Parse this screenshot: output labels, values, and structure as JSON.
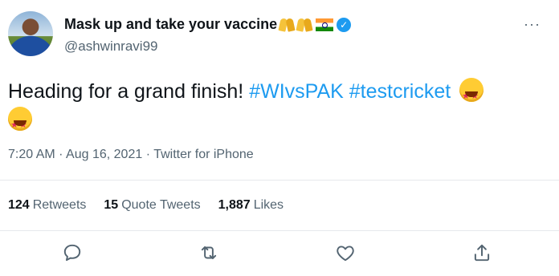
{
  "user": {
    "display_name": "Mask up and take your vaccine",
    "handle": "@ashwinravi99",
    "verified": true,
    "avatar": "avatar-photo"
  },
  "tweet": {
    "text_plain": "Heading for a grand finish! ",
    "hashtags": [
      "#WIvsPAK",
      "#testcricket"
    ],
    "emoji": "star-struck-emoji"
  },
  "meta": {
    "time": "7:20 AM",
    "separator": "·",
    "date": "Aug 16, 2021",
    "source": "Twitter for iPhone"
  },
  "stats": {
    "retweets_count": "124",
    "retweets_label": "Retweets",
    "quotes_count": "15",
    "quotes_label": "Quote Tweets",
    "likes_count": "1,887",
    "likes_label": "Likes"
  },
  "more_menu": "···",
  "actions": [
    "reply-icon",
    "retweet-icon",
    "like-icon",
    "share-icon"
  ],
  "colors": {
    "link": "#1d9bf0",
    "secondary_text": "#536471",
    "primary_text": "#0f1419",
    "verified": "#1d9bf0"
  }
}
